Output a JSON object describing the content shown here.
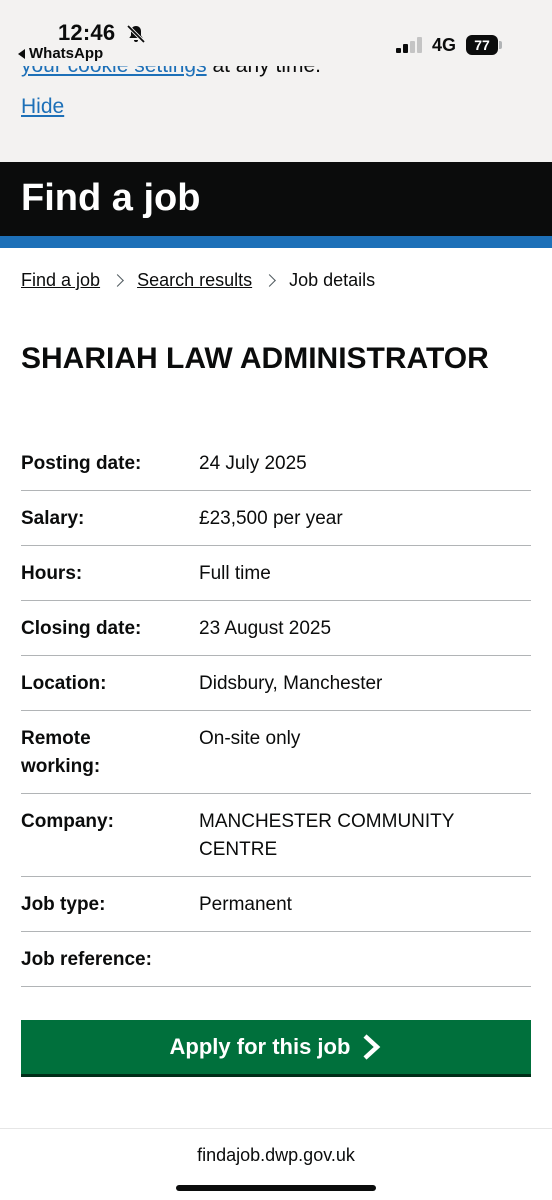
{
  "status_bar": {
    "time": "12:46",
    "back_app": "WhatsApp",
    "network": "4G",
    "battery": "77"
  },
  "cookie_banner": {
    "link_text": "your cookie settings",
    "trailing_text": " at any time.",
    "hide_label": "Hide"
  },
  "header": {
    "title": "Find a job"
  },
  "breadcrumb": {
    "items": [
      "Find a job",
      "Search results"
    ],
    "current": "Job details"
  },
  "job": {
    "title": "SHARIAH LAW ADMINISTRATOR",
    "details": [
      {
        "label": "Posting date:",
        "value": "24 July 2025"
      },
      {
        "label": "Salary:",
        "value": "£23,500 per year"
      },
      {
        "label": "Hours:",
        "value": "Full time"
      },
      {
        "label": "Closing date:",
        "value": "23 August 2025"
      },
      {
        "label": "Location:",
        "value": "Didsbury, Manchester"
      },
      {
        "label": "Remote working:",
        "value": "On-site only"
      },
      {
        "label": "Company:",
        "value": "MANCHESTER COMMUNITY CENTRE"
      },
      {
        "label": "Job type:",
        "value": "Permanent"
      },
      {
        "label": "Job reference:",
        "value": ""
      }
    ]
  },
  "apply_button": {
    "label": "Apply for this job"
  },
  "url_bar": {
    "url": "findajob.dwp.gov.uk"
  },
  "colors": {
    "header_bg": "#0b0c0c",
    "stripe": "#1d70b8",
    "link": "#1d70b8",
    "button": "#00703c",
    "banner_bg": "#f3f2f1"
  }
}
